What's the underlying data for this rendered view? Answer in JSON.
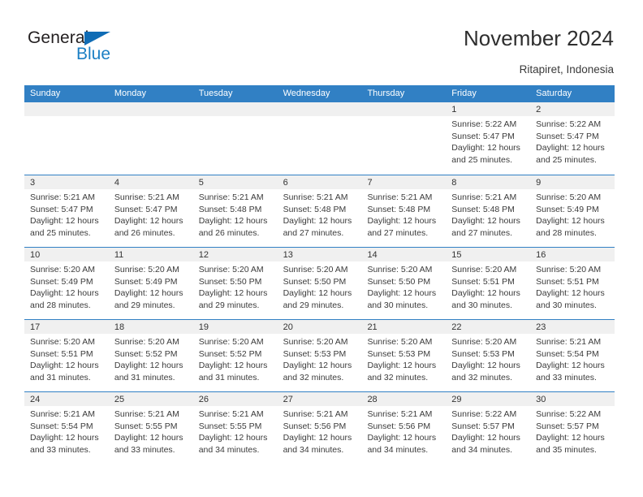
{
  "brand": {
    "line1": "General",
    "line2": "Blue",
    "triangle_color": "#0f6cb5",
    "line2_color": "#1b7fc4"
  },
  "header": {
    "title": "November 2024",
    "subtitle": "Ritapiret, Indonesia",
    "accent_color": "#3180c4",
    "band_color": "#f0f0f0"
  },
  "calendar": {
    "weekday_headers": [
      "Sunday",
      "Monday",
      "Tuesday",
      "Wednesday",
      "Thursday",
      "Friday",
      "Saturday"
    ],
    "weeks": [
      [
        {
          "day": "",
          "lines": []
        },
        {
          "day": "",
          "lines": []
        },
        {
          "day": "",
          "lines": []
        },
        {
          "day": "",
          "lines": []
        },
        {
          "day": "",
          "lines": []
        },
        {
          "day": "1",
          "lines": [
            "Sunrise: 5:22 AM",
            "Sunset: 5:47 PM",
            "Daylight: 12 hours",
            "and 25 minutes."
          ]
        },
        {
          "day": "2",
          "lines": [
            "Sunrise: 5:22 AM",
            "Sunset: 5:47 PM",
            "Daylight: 12 hours",
            "and 25 minutes."
          ]
        }
      ],
      [
        {
          "day": "3",
          "lines": [
            "Sunrise: 5:21 AM",
            "Sunset: 5:47 PM",
            "Daylight: 12 hours",
            "and 25 minutes."
          ]
        },
        {
          "day": "4",
          "lines": [
            "Sunrise: 5:21 AM",
            "Sunset: 5:47 PM",
            "Daylight: 12 hours",
            "and 26 minutes."
          ]
        },
        {
          "day": "5",
          "lines": [
            "Sunrise: 5:21 AM",
            "Sunset: 5:48 PM",
            "Daylight: 12 hours",
            "and 26 minutes."
          ]
        },
        {
          "day": "6",
          "lines": [
            "Sunrise: 5:21 AM",
            "Sunset: 5:48 PM",
            "Daylight: 12 hours",
            "and 27 minutes."
          ]
        },
        {
          "day": "7",
          "lines": [
            "Sunrise: 5:21 AM",
            "Sunset: 5:48 PM",
            "Daylight: 12 hours",
            "and 27 minutes."
          ]
        },
        {
          "day": "8",
          "lines": [
            "Sunrise: 5:21 AM",
            "Sunset: 5:48 PM",
            "Daylight: 12 hours",
            "and 27 minutes."
          ]
        },
        {
          "day": "9",
          "lines": [
            "Sunrise: 5:20 AM",
            "Sunset: 5:49 PM",
            "Daylight: 12 hours",
            "and 28 minutes."
          ]
        }
      ],
      [
        {
          "day": "10",
          "lines": [
            "Sunrise: 5:20 AM",
            "Sunset: 5:49 PM",
            "Daylight: 12 hours",
            "and 28 minutes."
          ]
        },
        {
          "day": "11",
          "lines": [
            "Sunrise: 5:20 AM",
            "Sunset: 5:49 PM",
            "Daylight: 12 hours",
            "and 29 minutes."
          ]
        },
        {
          "day": "12",
          "lines": [
            "Sunrise: 5:20 AM",
            "Sunset: 5:50 PM",
            "Daylight: 12 hours",
            "and 29 minutes."
          ]
        },
        {
          "day": "13",
          "lines": [
            "Sunrise: 5:20 AM",
            "Sunset: 5:50 PM",
            "Daylight: 12 hours",
            "and 29 minutes."
          ]
        },
        {
          "day": "14",
          "lines": [
            "Sunrise: 5:20 AM",
            "Sunset: 5:50 PM",
            "Daylight: 12 hours",
            "and 30 minutes."
          ]
        },
        {
          "day": "15",
          "lines": [
            "Sunrise: 5:20 AM",
            "Sunset: 5:51 PM",
            "Daylight: 12 hours",
            "and 30 minutes."
          ]
        },
        {
          "day": "16",
          "lines": [
            "Sunrise: 5:20 AM",
            "Sunset: 5:51 PM",
            "Daylight: 12 hours",
            "and 30 minutes."
          ]
        }
      ],
      [
        {
          "day": "17",
          "lines": [
            "Sunrise: 5:20 AM",
            "Sunset: 5:51 PM",
            "Daylight: 12 hours",
            "and 31 minutes."
          ]
        },
        {
          "day": "18",
          "lines": [
            "Sunrise: 5:20 AM",
            "Sunset: 5:52 PM",
            "Daylight: 12 hours",
            "and 31 minutes."
          ]
        },
        {
          "day": "19",
          "lines": [
            "Sunrise: 5:20 AM",
            "Sunset: 5:52 PM",
            "Daylight: 12 hours",
            "and 31 minutes."
          ]
        },
        {
          "day": "20",
          "lines": [
            "Sunrise: 5:20 AM",
            "Sunset: 5:53 PM",
            "Daylight: 12 hours",
            "and 32 minutes."
          ]
        },
        {
          "day": "21",
          "lines": [
            "Sunrise: 5:20 AM",
            "Sunset: 5:53 PM",
            "Daylight: 12 hours",
            "and 32 minutes."
          ]
        },
        {
          "day": "22",
          "lines": [
            "Sunrise: 5:20 AM",
            "Sunset: 5:53 PM",
            "Daylight: 12 hours",
            "and 32 minutes."
          ]
        },
        {
          "day": "23",
          "lines": [
            "Sunrise: 5:21 AM",
            "Sunset: 5:54 PM",
            "Daylight: 12 hours",
            "and 33 minutes."
          ]
        }
      ],
      [
        {
          "day": "24",
          "lines": [
            "Sunrise: 5:21 AM",
            "Sunset: 5:54 PM",
            "Daylight: 12 hours",
            "and 33 minutes."
          ]
        },
        {
          "day": "25",
          "lines": [
            "Sunrise: 5:21 AM",
            "Sunset: 5:55 PM",
            "Daylight: 12 hours",
            "and 33 minutes."
          ]
        },
        {
          "day": "26",
          "lines": [
            "Sunrise: 5:21 AM",
            "Sunset: 5:55 PM",
            "Daylight: 12 hours",
            "and 34 minutes."
          ]
        },
        {
          "day": "27",
          "lines": [
            "Sunrise: 5:21 AM",
            "Sunset: 5:56 PM",
            "Daylight: 12 hours",
            "and 34 minutes."
          ]
        },
        {
          "day": "28",
          "lines": [
            "Sunrise: 5:21 AM",
            "Sunset: 5:56 PM",
            "Daylight: 12 hours",
            "and 34 minutes."
          ]
        },
        {
          "day": "29",
          "lines": [
            "Sunrise: 5:22 AM",
            "Sunset: 5:57 PM",
            "Daylight: 12 hours",
            "and 34 minutes."
          ]
        },
        {
          "day": "30",
          "lines": [
            "Sunrise: 5:22 AM",
            "Sunset: 5:57 PM",
            "Daylight: 12 hours",
            "and 35 minutes."
          ]
        }
      ]
    ]
  }
}
